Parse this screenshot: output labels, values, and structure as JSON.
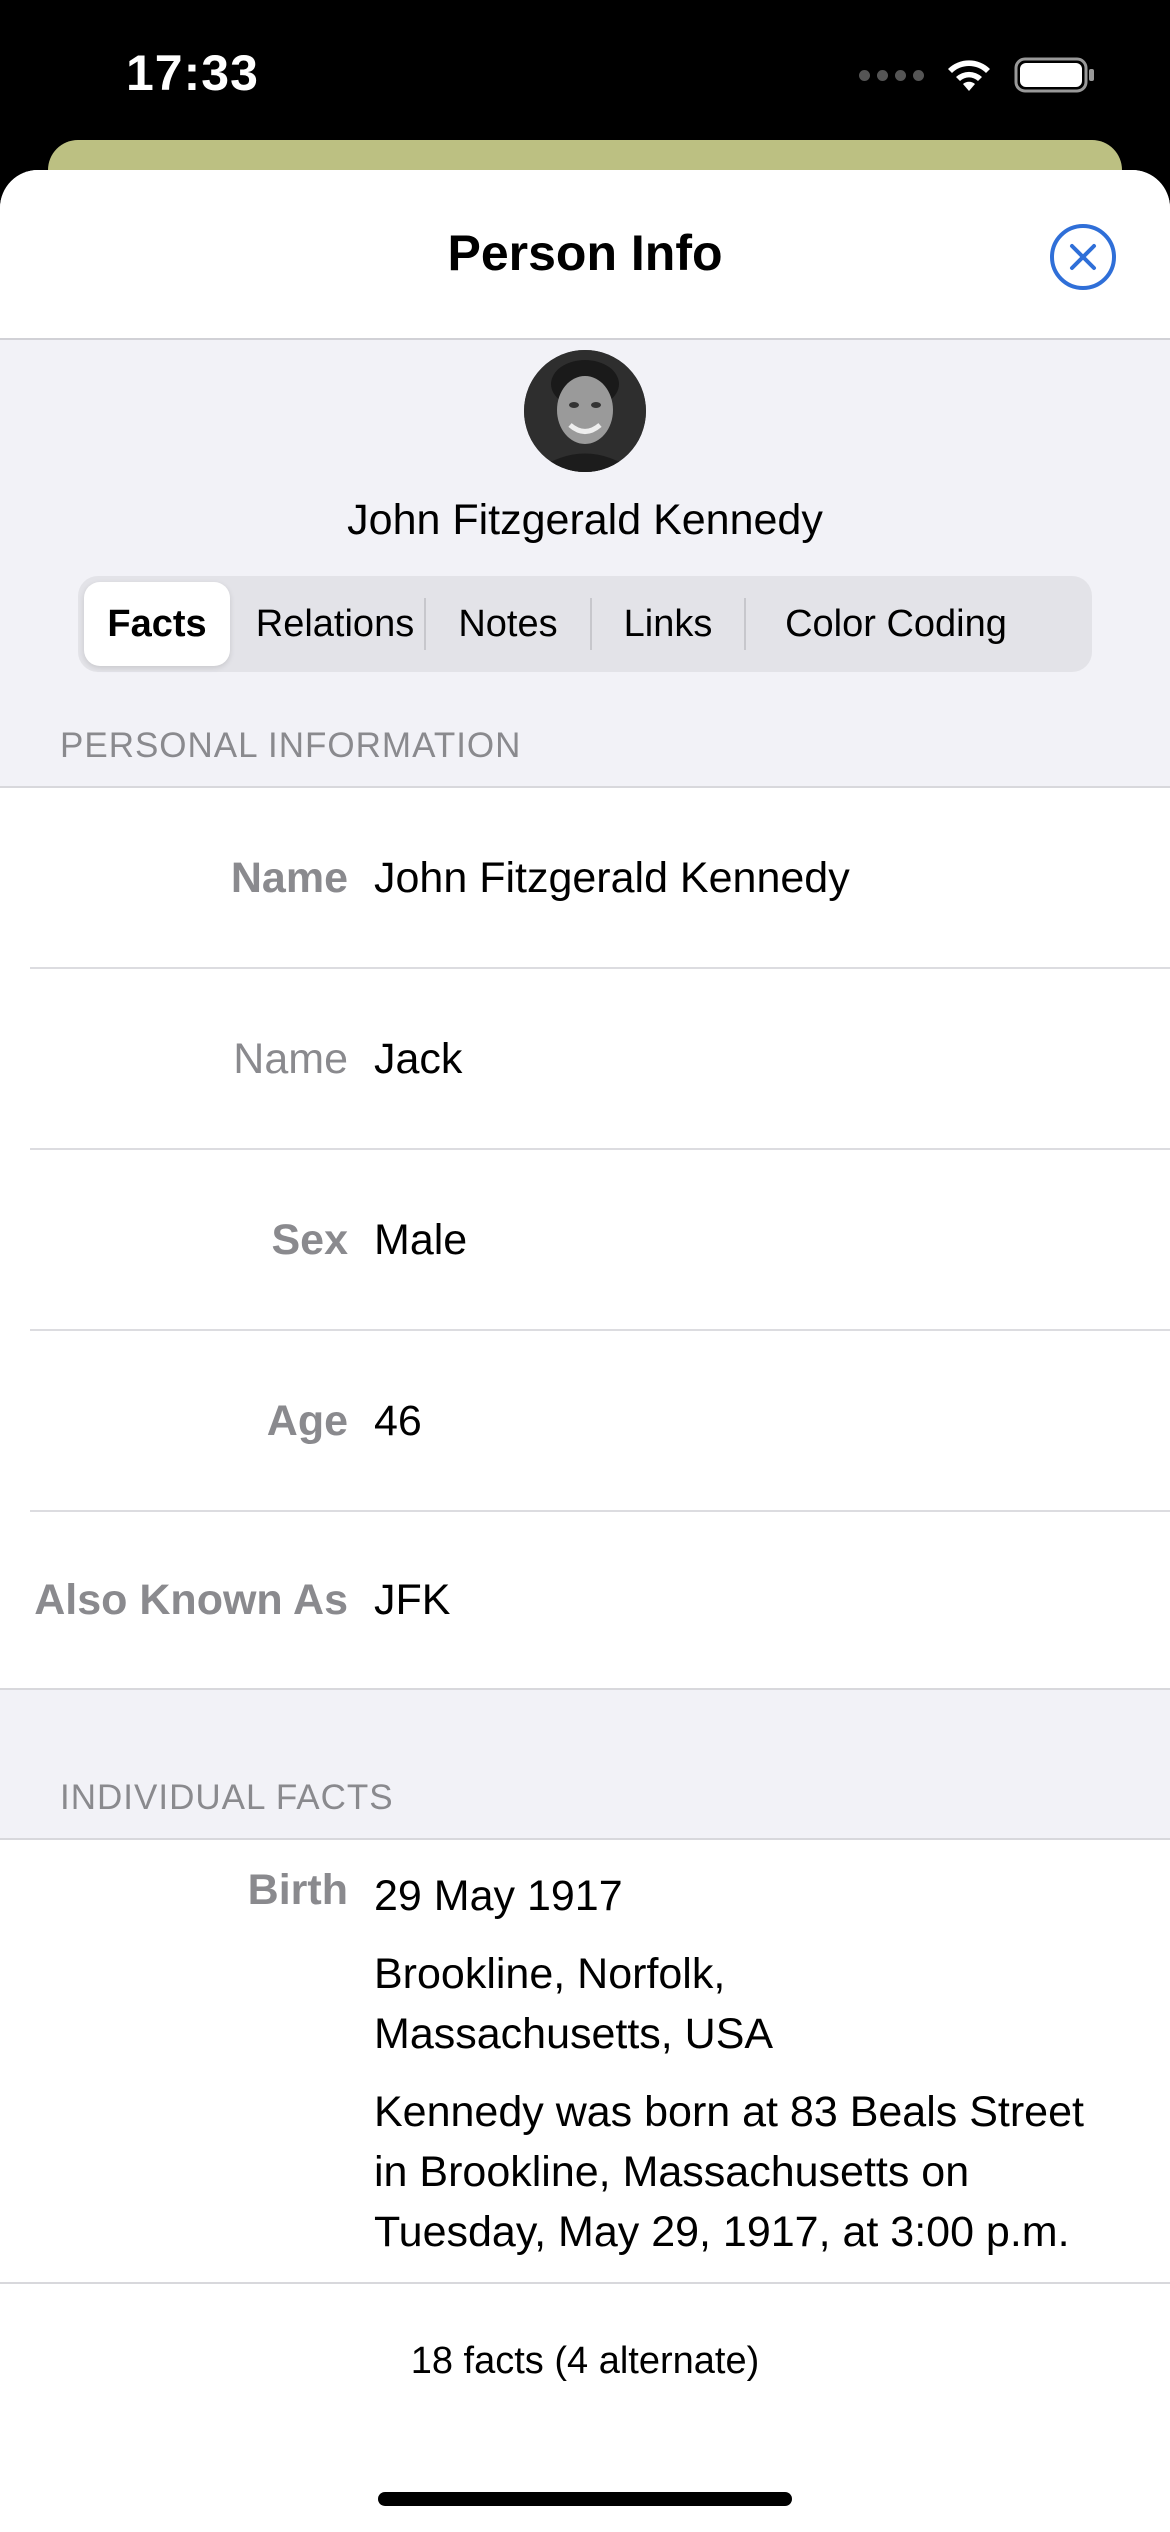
{
  "status_bar": {
    "time": "17:33"
  },
  "nav": {
    "title": "Person Info"
  },
  "person": {
    "full_name": "John Fitzgerald Kennedy"
  },
  "tabs": [
    {
      "label": "Facts",
      "selected": true
    },
    {
      "label": "Relations",
      "selected": false
    },
    {
      "label": "Notes",
      "selected": false
    },
    {
      "label": "Links",
      "selected": false
    },
    {
      "label": "Color Coding",
      "selected": false
    }
  ],
  "personal_information": {
    "header": "PERSONAL INFORMATION",
    "rows": [
      {
        "label": "Name",
        "value": "John Fitzgerald Kennedy",
        "primary": true
      },
      {
        "label": "Name",
        "value": "Jack",
        "primary": false
      },
      {
        "label": "Sex",
        "value": "Male",
        "primary": true
      },
      {
        "label": "Age",
        "value": "46",
        "primary": true
      },
      {
        "label": "Also Known As",
        "value": "JFK",
        "primary": true
      }
    ]
  },
  "individual_facts": {
    "header": "INDIVIDUAL FACTS",
    "items": [
      {
        "label": "Birth",
        "date": "29 May 1917",
        "place": "Brookline, Norfolk, Massachusetts, USA",
        "description": "Kennedy was born at 83 Beals Street in Brookline, Massachusetts on Tuesday, May 29, 1917, at 3:00 p.m."
      }
    ]
  },
  "footer": {
    "summary": "18 facts (4 alternate)"
  },
  "icons": {
    "close": "close-circle-icon",
    "wifi": "wifi-icon",
    "battery": "battery-icon",
    "avatar": "person-photo"
  },
  "colors": {
    "accent": "#2f6fd8",
    "underlay": "#bcc082",
    "background": "#f2f2f7"
  }
}
